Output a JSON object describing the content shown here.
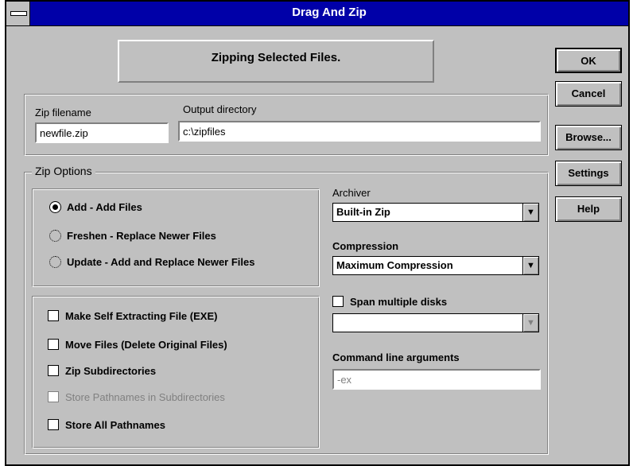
{
  "window": {
    "title": "Drag And Zip"
  },
  "status": {
    "text": "Zipping Selected Files."
  },
  "buttons": {
    "ok": "OK",
    "cancel": "Cancel",
    "browse": "Browse...",
    "settings": "Settings",
    "help": "Help"
  },
  "zip_filename": {
    "label": "Zip filename",
    "value": "newfile.zip"
  },
  "output_directory": {
    "label": "Output directory",
    "value": "c:\\zipfiles"
  },
  "zip_options": {
    "label": "Zip Options",
    "modes": [
      {
        "label": "Add - Add Files",
        "selected": true
      },
      {
        "label": "Freshen - Replace Newer Files",
        "selected": false
      },
      {
        "label": "Update - Add and Replace Newer Files",
        "selected": false
      }
    ],
    "checkboxes": [
      {
        "label": "Make Self Extracting File (EXE)",
        "checked": false,
        "enabled": true
      },
      {
        "label": "Move Files (Delete Original Files)",
        "checked": false,
        "enabled": true
      },
      {
        "label": "Zip Subdirectories",
        "checked": false,
        "enabled": true
      },
      {
        "label": "Store Pathnames in Subdirectories",
        "checked": false,
        "enabled": false
      },
      {
        "label": "Store All Pathnames",
        "checked": false,
        "enabled": true
      }
    ]
  },
  "archiver": {
    "label": "Archiver",
    "value": "Built-in Zip"
  },
  "compression": {
    "label": "Compression",
    "value": "Maximum Compression"
  },
  "span_disks": {
    "label": "Span multiple disks",
    "checked": false,
    "value": ""
  },
  "command_line": {
    "label": "Command line arguments",
    "value": "-ex"
  }
}
